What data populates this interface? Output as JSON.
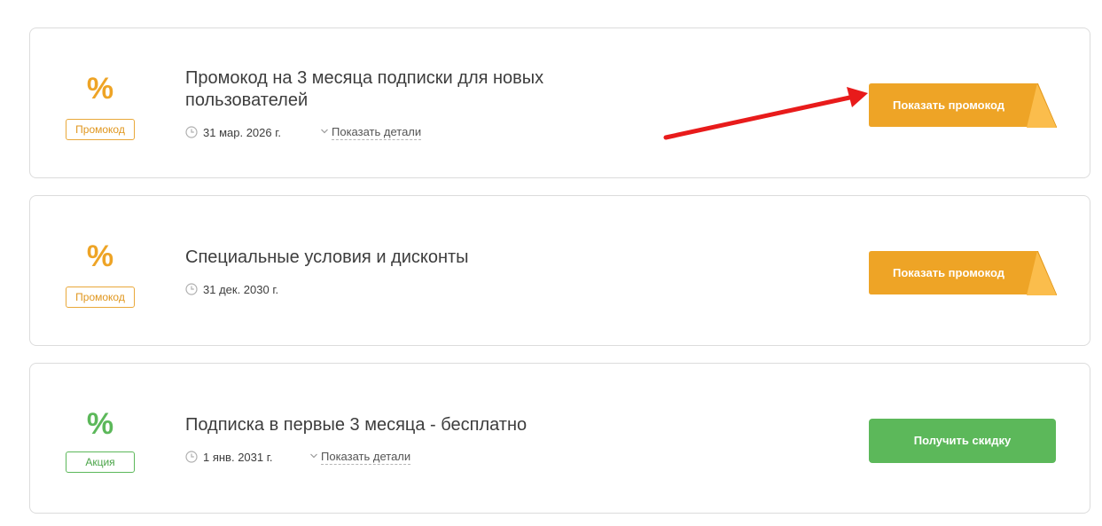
{
  "colors": {
    "promo_orange": "#eea426",
    "promo_orange_dark": "#dd9319",
    "promo_fold": "#fbbd4c",
    "action_green": "#5cb85a",
    "annotation_red": "#e81b1b",
    "card_border": "#dcdcdc",
    "text_main": "#3d3d3d"
  },
  "offers": [
    {
      "badge_icon": "%",
      "badge_label": "Промокод",
      "title": "Промокод на 3 месяца подписки для новых пользователей",
      "date": "31 мар. 2026 г.",
      "details_label": "Показать детали",
      "cta_label": "Показать промокод",
      "cta_style": "promo-orange"
    },
    {
      "badge_icon": "%",
      "badge_label": "Промокод",
      "title": "Специальные условия и дисконты",
      "date": "31 дек. 2030 г.",
      "cta_label": "Показать промокод",
      "cta_style": "promo-orange"
    },
    {
      "badge_icon": "%",
      "badge_label": "Акция",
      "title": "Подписка в первые 3 месяца - бесплатно",
      "date": "1 янв. 2031 г.",
      "details_label": "Показать детали",
      "cta_label": "Получить скидку",
      "cta_style": "action-green"
    }
  ],
  "annotation": {
    "type": "arrow",
    "icon": "arrow-right-icon",
    "color": "#e81b1b"
  }
}
